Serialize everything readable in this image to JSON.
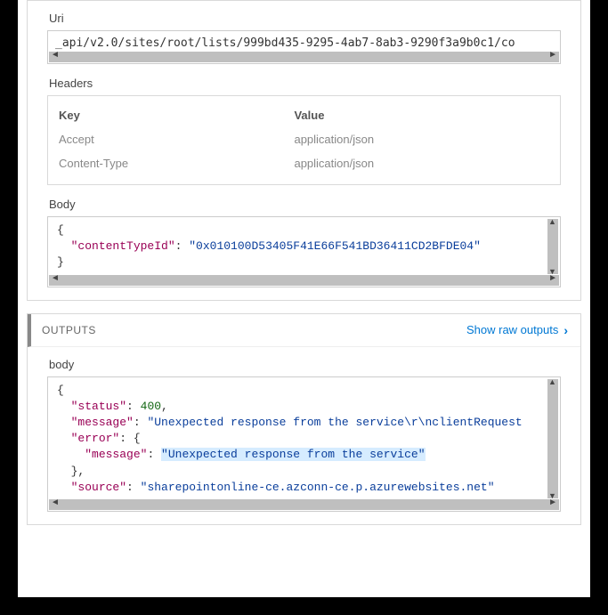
{
  "inputs": {
    "uri_label": "Uri",
    "uri_value": "_api/v2.0/sites/root/lists/999bd435-9295-4ab7-8ab3-9290f3a9b0c1/co",
    "headers_label": "Headers",
    "headers_key_heading": "Key",
    "headers_value_heading": "Value",
    "headers": [
      {
        "key": "Accept",
        "value": "application/json"
      },
      {
        "key": "Content-Type",
        "value": "application/json"
      }
    ],
    "body_label": "Body",
    "body_lines": {
      "open": "{",
      "indent": "  ",
      "key": "\"contentTypeId\"",
      "colon": ": ",
      "value": "\"0x010100D53405F41E66F541BD36411CD2BFDE04\"",
      "close": "}"
    }
  },
  "outputs": {
    "section_title": "OUTPUTS",
    "show_raw_label": "Show raw outputs",
    "body_label": "body",
    "body_lines": {
      "open": "{",
      "status_key": "\"status\"",
      "status_val": "400",
      "message_key": "\"message\"",
      "message_val": "\"Unexpected response from the service\\r\\nclientRequest",
      "error_key": "\"error\"",
      "error_open": "{",
      "inner_message_key": "\"message\"",
      "inner_message_val": "\"Unexpected response from the service\"",
      "error_close": "},",
      "source_key": "\"source\"",
      "source_val": "\"sharepointonline-ce.azconn-ce.p.azurewebsites.net\""
    }
  }
}
